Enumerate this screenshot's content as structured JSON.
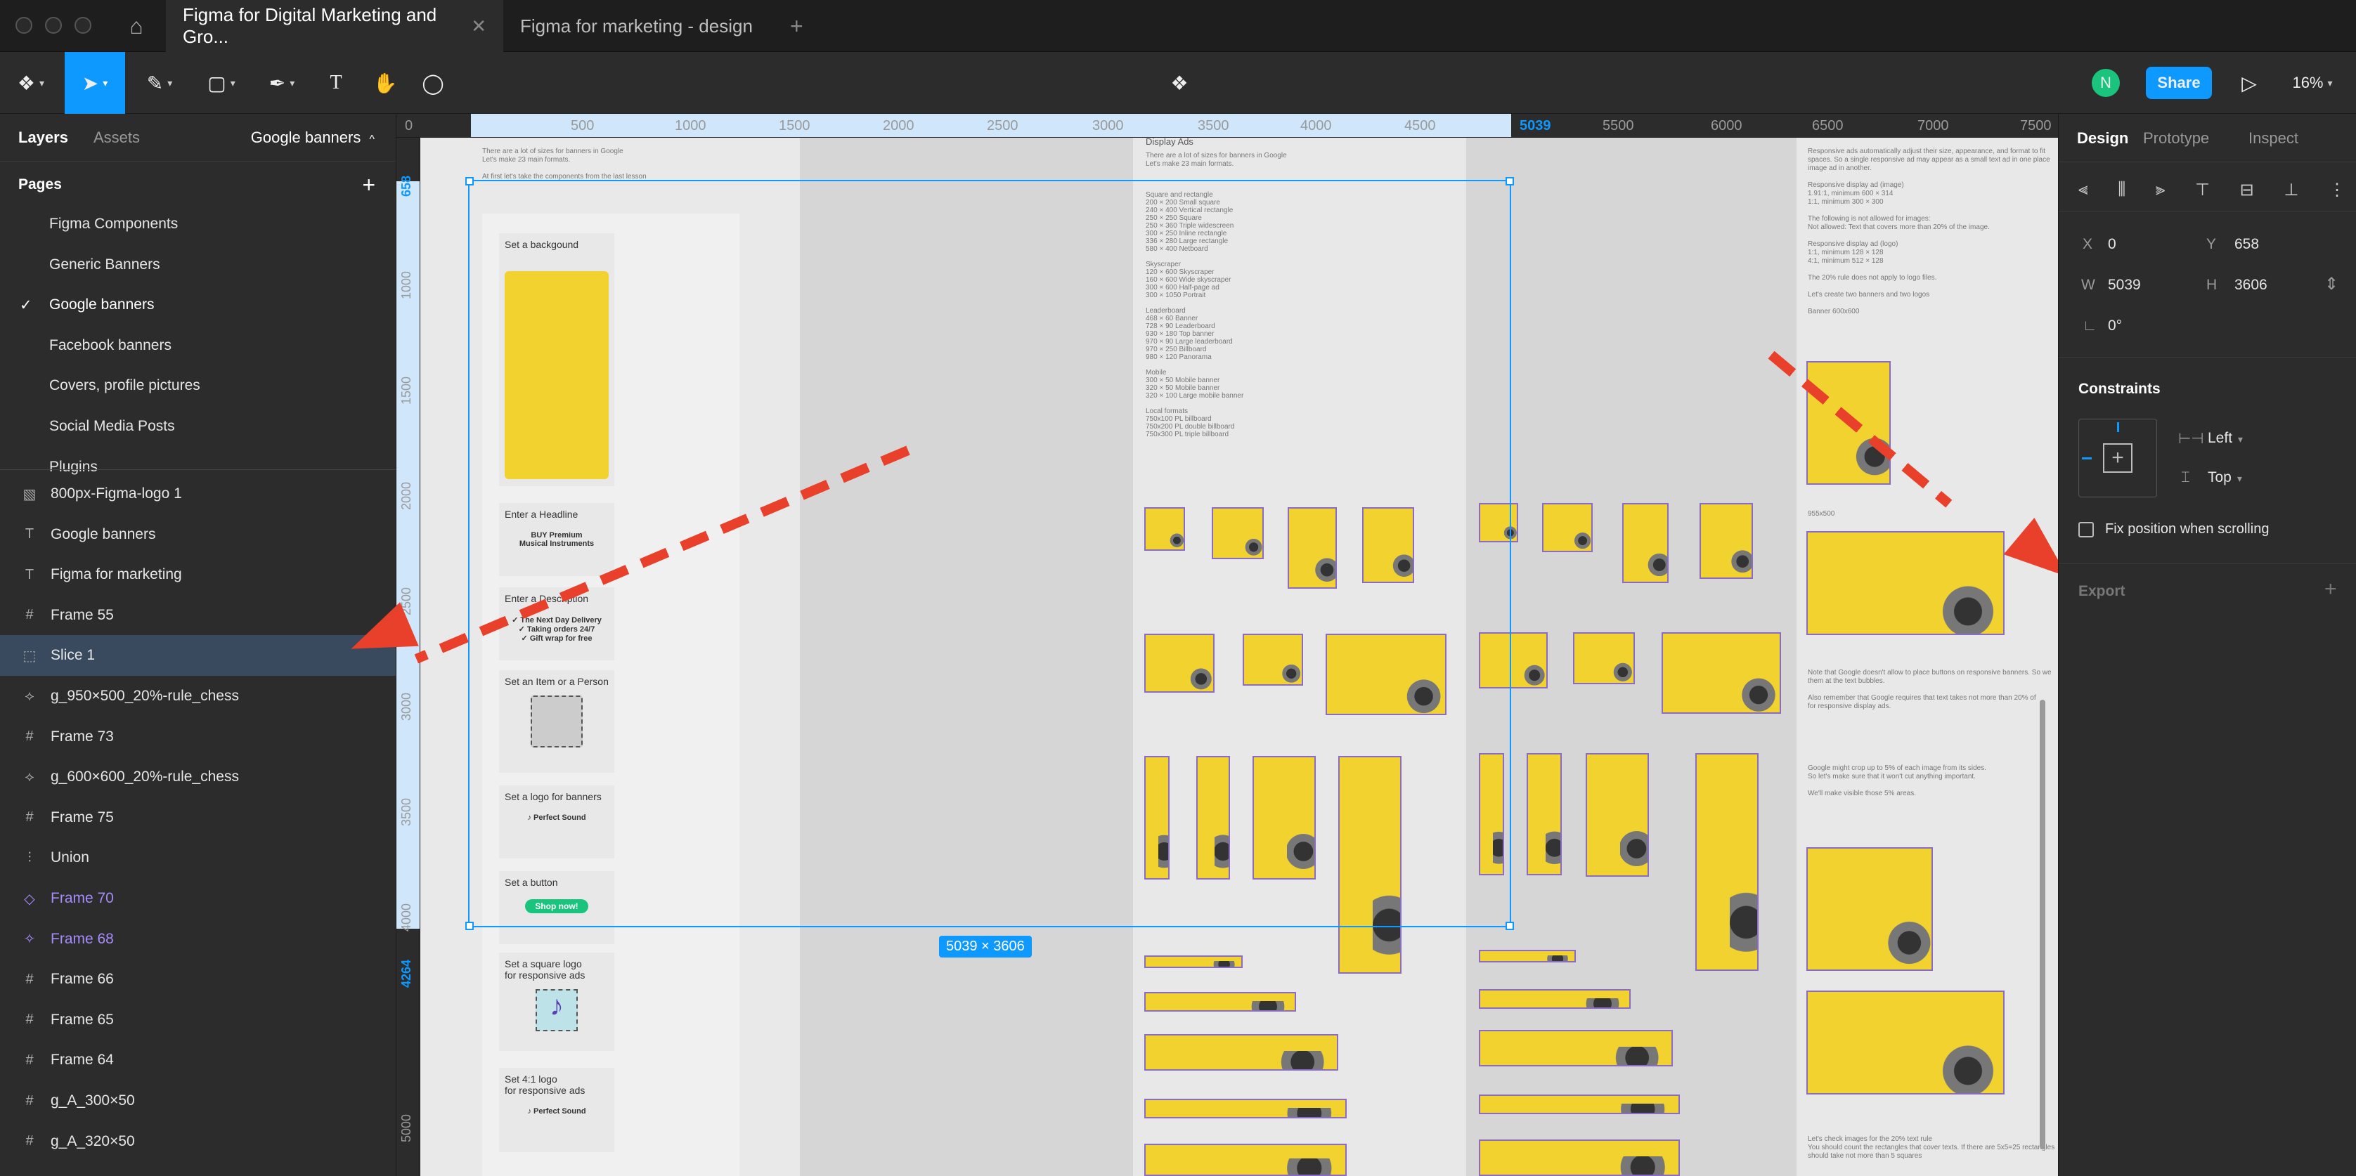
{
  "tabs": {
    "home_icon": "home-icon",
    "active": "Figma for Digital Marketing and Gro...",
    "inactive": "Figma for marketing - design"
  },
  "toolbar": {
    "avatar_letter": "N",
    "share_label": "Share",
    "zoom": "16%"
  },
  "left": {
    "tab_layers": "Layers",
    "tab_assets": "Assets",
    "page_selector": "Google banners",
    "pages_header": "Pages",
    "pages": [
      "Figma Components",
      "Generic Banners",
      "Google banners",
      "Facebook banners",
      "Covers, profile pictures",
      "Social Media Posts",
      "Plugins"
    ],
    "current_page_check": "✓",
    "layers": [
      {
        "label": "800px-Figma-logo 1",
        "icon": "image-icon",
        "glyph": "▧"
      },
      {
        "label": "Google banners",
        "icon": "text-icon",
        "glyph": "T"
      },
      {
        "label": "Figma for marketing",
        "icon": "text-icon",
        "glyph": "T"
      },
      {
        "label": "Frame 55",
        "icon": "frame-icon",
        "glyph": "#"
      },
      {
        "label": "Slice 1",
        "icon": "slice-icon",
        "glyph": "⬚"
      },
      {
        "label": "g_950×500_20%-rule_chess",
        "icon": "instance-icon",
        "glyph": "⟡"
      },
      {
        "label": "Frame 73",
        "icon": "frame-icon",
        "glyph": "#"
      },
      {
        "label": "g_600×600_20%-rule_chess",
        "icon": "instance-icon",
        "glyph": "⟡"
      },
      {
        "label": "Frame 75",
        "icon": "frame-icon",
        "glyph": "#"
      },
      {
        "label": "Union",
        "icon": "union-icon",
        "glyph": "⫶"
      },
      {
        "label": "Frame 70",
        "icon": "component-icon",
        "glyph": "◇"
      },
      {
        "label": "Frame 68",
        "icon": "component-set-icon",
        "glyph": "✧"
      },
      {
        "label": "Frame 66",
        "icon": "frame-icon",
        "glyph": "#"
      },
      {
        "label": "Frame 65",
        "icon": "frame-icon",
        "glyph": "#"
      },
      {
        "label": "Frame 64",
        "icon": "frame-icon",
        "glyph": "#"
      },
      {
        "label": "g_A_300×50",
        "icon": "frame-icon",
        "glyph": "#"
      },
      {
        "label": "g_A_320×50",
        "icon": "frame-icon",
        "glyph": "#"
      }
    ]
  },
  "rulers": {
    "top": [
      "0",
      "500",
      "1000",
      "1500",
      "2000",
      "2500",
      "3000",
      "3500",
      "4000",
      "4500",
      "5039",
      "5500",
      "6000",
      "6500",
      "7000",
      "7500"
    ],
    "left": [
      "658",
      "1000",
      "1500",
      "2000",
      "2500",
      "3000",
      "3500",
      "4000",
      "4264",
      "5000"
    ]
  },
  "canvas": {
    "selection_size": "5039 × 3606",
    "heading_display_ads": "Display Ads",
    "intro_left": "There are a lot of sizes for banners in Google\nLet's make 23 main formats.",
    "intro_left2": "At first let's take the components from the last lesson",
    "intro_mid": "There are a lot of sizes for banners in Google\nLet's make 23 main formats.",
    "sizes_list": "Square and rectangle\n200 × 200 Small square\n240 × 400 Vertical rectangle\n250 × 250 Square\n250 × 360 Triple widescreen\n300 × 250 Inline rectangle\n336 × 280 Large rectangle\n580 × 400 Netboard\n\nSkyscraper\n120 × 600 Skyscraper\n160 × 600 Wide skyscraper\n300 × 600 Half-page ad\n300 × 1050 Portrait\n\nLeaderboard\n468 × 60 Banner\n728 × 90 Leaderboard\n930 × 180 Top banner\n970 × 90 Large leaderboard\n970 × 250 Billboard\n980 × 120 Panorama\n\nMobile\n300 × 50 Mobile banner\n320 × 50 Mobile banner\n320 × 100 Large mobile banner\n\nLocal formats\n750x100 PL billboard\n750x200 PL double billboard\n750x300 PL triple billboard",
    "right_notes": "Responsive ads automatically adjust their size, appearance, and format to fit\nspaces. So a single responsive ad may appear as a small text ad in one place\nimage ad in another.\n\nResponsive display ad (image)\n1.91:1, minimum 600 × 314\n1:1, minimum 300 × 300\n\nThe following is not allowed for images:\nNot allowed: Text that covers more than 20% of the image.\n\nResponsive display ad (logo)\n1:1, minimum 128 × 128\n4:1, minimum 512 × 128\n\nThe 20% rule does not apply to logo files.\n\nLet's create two banners and two logos\n\nBanner 600x600",
    "note_955": "955x500",
    "right_notes2": "Note that Google doesn't allow to place buttons on responsive banners. So we\nthem at the text bubbles.\n\nAlso remember that Google requires that text takes not more than 20% of\nfor responsive display ads.",
    "right_notes3": "Google might crop up to 5% of each image from its sides.\nSo let's make sure that it won't cut anything important.\n\nWe'll make visible those 5% areas.",
    "right_notes4": "Let's check images for the 20% text rule\nYou should count the rectangles that cover texts. If there are 5x5=25 rectangles\nshould take not more than 5 squares",
    "cards": [
      {
        "title": "Set a backgound"
      },
      {
        "title": "Enter a Headline",
        "body": "BUY Premium\nMusical Instruments"
      },
      {
        "title": "Enter a Description",
        "body": "✓ The Next Day Delivery\n✓ Taking orders 24/7\n✓ Gift wrap for free"
      },
      {
        "title": "Set an Item or a Person"
      },
      {
        "title": "Set a logo for banners",
        "body": "♪ Perfect Sound"
      },
      {
        "title": "Set a button",
        "body": "Shop now!"
      },
      {
        "title": "Set a square logo\nfor responsive ads"
      },
      {
        "title": "Set 4:1 logo\nfor responsive ads",
        "body": "♪ Perfect Sound"
      }
    ]
  },
  "right": {
    "tab_design": "Design",
    "tab_prototype": "Prototype",
    "tab_inspect": "Inspect",
    "x_label": "X",
    "x_val": "0",
    "y_label": "Y",
    "y_val": "658",
    "w_label": "W",
    "w_val": "5039",
    "h_label": "H",
    "h_val": "3606",
    "rotation": "0°",
    "constraints_header": "Constraints",
    "constraint_h": "Left",
    "constraint_v": "Top",
    "fix_position": "Fix position when scrolling",
    "export_header": "Export"
  },
  "colors": {
    "accent": "#0d99ff",
    "annotation_arrow": "#e8402a",
    "banner_yellow": "#f2d22e",
    "selection": "#0d99ff",
    "green_button": "#1bc47d"
  }
}
